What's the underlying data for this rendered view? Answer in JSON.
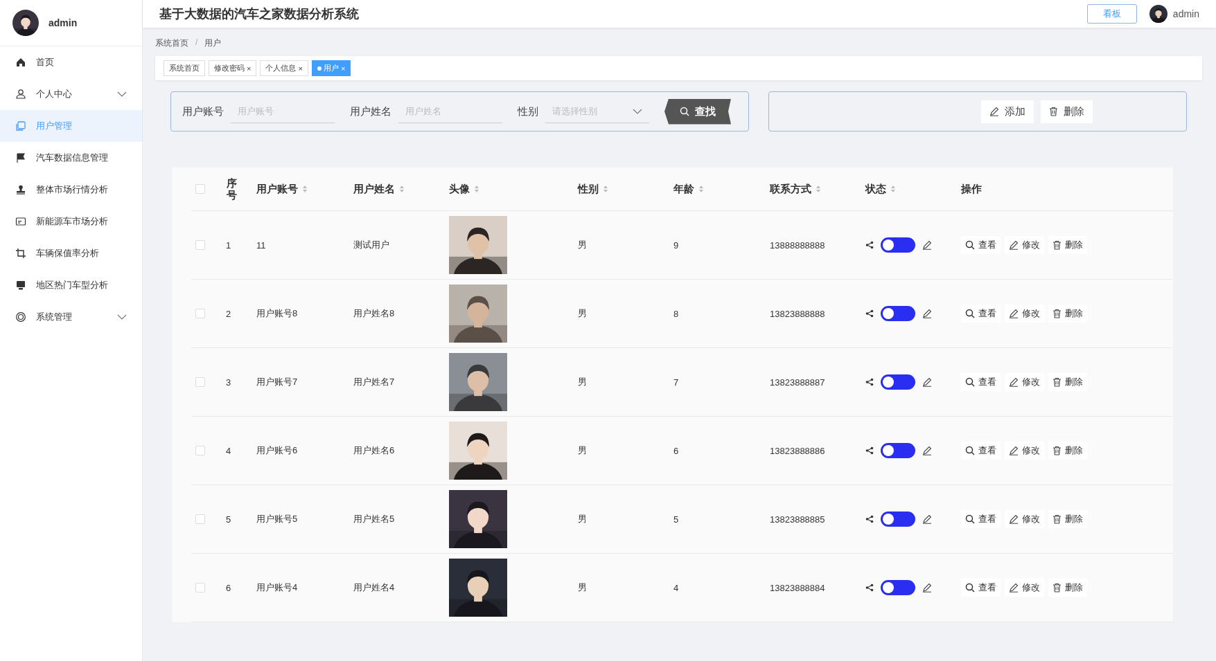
{
  "header": {
    "title": "基于大数据的汽车之家数据分析系统",
    "dashboard_button": "看板",
    "user": "admin"
  },
  "sidebar": {
    "user": "admin",
    "items": [
      {
        "label": "首页",
        "expandable": false,
        "selected": false
      },
      {
        "label": "个人中心",
        "expandable": true,
        "selected": false
      },
      {
        "label": "用户管理",
        "expandable": false,
        "selected": true
      },
      {
        "label": "汽车数据信息管理",
        "expandable": false,
        "selected": false
      },
      {
        "label": "整体市场行情分析",
        "expandable": false,
        "selected": false
      },
      {
        "label": "新能源车市场分析",
        "expandable": false,
        "selected": false
      },
      {
        "label": "车辆保值率分析",
        "expandable": false,
        "selected": false
      },
      {
        "label": "地区热门车型分析",
        "expandable": false,
        "selected": false
      },
      {
        "label": "系统管理",
        "expandable": true,
        "selected": false
      }
    ]
  },
  "breadcrumb": {
    "items": [
      "系统首页",
      "用户"
    ],
    "separator": "/"
  },
  "tabs": [
    {
      "label": "系统首页",
      "selected": false
    },
    {
      "label": "修改密码",
      "close": "×",
      "selected": false
    },
    {
      "label": "个人信息",
      "close": "×",
      "selected": false
    },
    {
      "label": "用户",
      "close": "×",
      "selected": true
    }
  ],
  "search": {
    "fields": [
      {
        "label": "用户账号",
        "placeholder": "用户账号",
        "kind": "input"
      },
      {
        "label": "用户姓名",
        "placeholder": "用户姓名",
        "kind": "input"
      },
      {
        "label": "性别",
        "placeholder": "请选择性别",
        "kind": "select"
      }
    ],
    "button": "查找"
  },
  "actions": [
    {
      "label": "添加",
      "kind": "add"
    },
    {
      "label": "删除",
      "kind": "delete"
    }
  ],
  "table": {
    "select_all_checked": false,
    "columns": [
      {
        "label": "序号",
        "sortable": false
      },
      {
        "label": "用户账号",
        "sortable": true
      },
      {
        "label": "用户姓名",
        "sortable": true
      },
      {
        "label": "头像",
        "sortable": true
      },
      {
        "label": "性别",
        "sortable": true
      },
      {
        "label": "年龄",
        "sortable": true
      },
      {
        "label": "联系方式",
        "sortable": true
      },
      {
        "label": "状态",
        "sortable": true
      },
      {
        "label": "操作",
        "sortable": false
      }
    ],
    "rows": [
      {
        "checked": false,
        "index": "1",
        "account": "11",
        "name": "测试用户",
        "avatar": {
          "kind": "picture"
        },
        "gender": "男",
        "age": "9",
        "phone": "13888888888",
        "on": false,
        "actions": [
          "查看",
          "修改",
          "删除"
        ]
      },
      {
        "checked": false,
        "index": "2",
        "account": "用户账号8",
        "name": "用户姓名8",
        "avatar": {
          "kind": "picture"
        },
        "gender": "男",
        "age": "8",
        "phone": "13823888888",
        "on": false,
        "actions": [
          "查看",
          "修改",
          "删除"
        ]
      },
      {
        "checked": false,
        "index": "3",
        "account": "用户账号7",
        "name": "用户姓名7",
        "avatar": {
          "kind": "picture"
        },
        "gender": "男",
        "age": "7",
        "phone": "13823888887",
        "on": false,
        "actions": [
          "查看",
          "修改",
          "删除"
        ]
      },
      {
        "checked": false,
        "index": "4",
        "account": "用户账号6",
        "name": "用户姓名6",
        "avatar": {
          "kind": "picture"
        },
        "gender": "男",
        "age": "6",
        "phone": "13823888886",
        "on": false,
        "actions": [
          "查看",
          "修改",
          "删除"
        ]
      },
      {
        "checked": false,
        "index": "5",
        "account": "用户账号5",
        "name": "用户姓名5",
        "avatar": {
          "kind": "picture"
        },
        "gender": "男",
        "age": "5",
        "phone": "13823888885",
        "on": false,
        "actions": [
          "查看",
          "修改",
          "删除"
        ]
      },
      {
        "checked": false,
        "index": "6",
        "account": "用户账号4",
        "name": "用户姓名4",
        "avatar": {
          "kind": "picture"
        },
        "gender": "男",
        "age": "4",
        "phone": "13823888884",
        "on": false,
        "actions": [
          "查看",
          "修改",
          "删除"
        ]
      }
    ]
  }
}
